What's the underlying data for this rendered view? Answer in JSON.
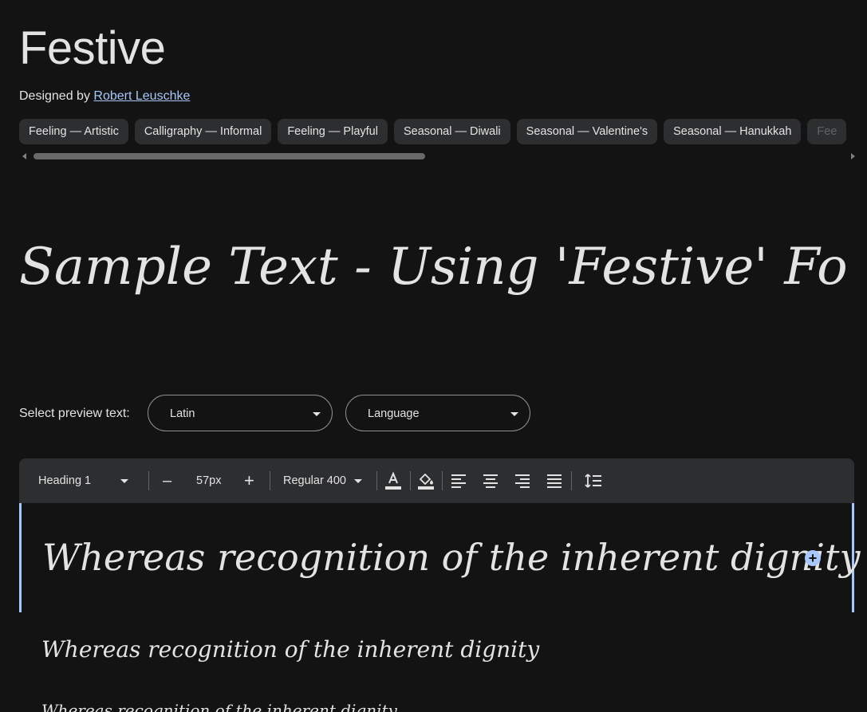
{
  "font": {
    "name": "Festive",
    "designed_by_label": "Designed by",
    "designer": "Robert Leuschke"
  },
  "tags": [
    "Feeling — Artistic",
    "Calligraphy — Informal",
    "Feeling — Playful",
    "Seasonal — Diwali",
    "Seasonal — Valentine's",
    "Seasonal — Hanukkah",
    "Fee"
  ],
  "sample_text": "Sample Text - Using 'Festive' Font.",
  "preview": {
    "label": "Select preview text:",
    "script_value": "Latin",
    "language_placeholder": "Language"
  },
  "toolbar": {
    "style_value": "Heading 1",
    "decrease_label": "–",
    "size_value": "57px",
    "increase_label": "+",
    "weight_value": "Regular 400"
  },
  "editor": {
    "heading_text": "Whereas recognition of the inherent dignity",
    "add_label": "+",
    "line2_text": "Whereas recognition of the inherent dignity",
    "line3_text": "Whereas recognition of the inherent dignity"
  },
  "colors": {
    "background": "#131314",
    "accent": "#a8c7fa",
    "chip": "#2d2e30"
  }
}
